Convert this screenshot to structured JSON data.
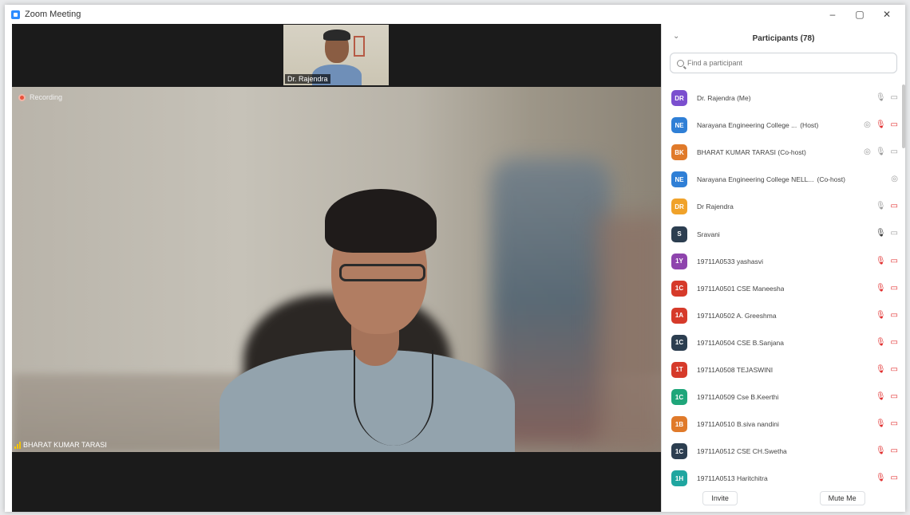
{
  "window": {
    "title": "Zoom Meeting",
    "controls": [
      "–",
      "▢",
      "✕"
    ]
  },
  "video": {
    "thumbnail_name": "Dr. Rajendra",
    "recording_label": "Recording",
    "speaker_name": "BHARAT KUMAR TARASI"
  },
  "participants": {
    "title": "Participants (78)",
    "search_placeholder": "Find a participant",
    "list": [
      {
        "initials": "DR",
        "color": "#7b4fcf",
        "name": "Dr. Rajendra (Me)",
        "role": "",
        "icons": [
          "mic",
          "cam"
        ]
      },
      {
        "initials": "NE",
        "color": "#2f7fd6",
        "name": "Narayana Engineering College ...",
        "role": "(Host)",
        "icons": [
          "share",
          "mic-muted",
          "cam-off"
        ]
      },
      {
        "initials": "BK",
        "color": "#e07a2a",
        "name": "BHARAT KUMAR TARASI (Co-host)",
        "role": "",
        "icons": [
          "share",
          "mic",
          "cam"
        ]
      },
      {
        "initials": "NE",
        "color": "#2f7fd6",
        "name": "Narayana Engineering College NELL...",
        "role": "(Co-host)",
        "icons": [
          "share"
        ]
      },
      {
        "initials": "DR",
        "color": "#f0a22a",
        "name": "Dr Rajendra",
        "role": "",
        "icons": [
          "mic",
          "cam-off"
        ]
      },
      {
        "initials": "S",
        "color": "#2c3e50",
        "name": "Sravani",
        "role": "",
        "icons": [
          "mic-dark",
          "cam"
        ]
      },
      {
        "initials": "1Y",
        "color": "#8e44ad",
        "name": "19711A0533 yashasvi",
        "role": "",
        "icons": [
          "mic-muted",
          "cam-off"
        ]
      },
      {
        "initials": "1C",
        "color": "#d63a2a",
        "name": "19711A0501 CSE Maneesha",
        "role": "",
        "icons": [
          "mic-muted",
          "cam-off"
        ]
      },
      {
        "initials": "1A",
        "color": "#d63a2a",
        "name": "19711A0502 A. Greeshma",
        "role": "",
        "icons": [
          "mic-muted",
          "cam-off"
        ]
      },
      {
        "initials": "1C",
        "color": "#2c3e50",
        "name": "19711A0504 CSE B.Sanjana",
        "role": "",
        "icons": [
          "mic-muted",
          "cam-off"
        ]
      },
      {
        "initials": "1T",
        "color": "#d63a2a",
        "name": "19711A0508 TEJASWINI",
        "role": "",
        "icons": [
          "mic-muted",
          "cam-off"
        ]
      },
      {
        "initials": "1C",
        "color": "#1fa67a",
        "name": "19711A0509 Cse B.Keerthi",
        "role": "",
        "icons": [
          "mic-muted",
          "cam-off"
        ]
      },
      {
        "initials": "1B",
        "color": "#e07a2a",
        "name": "19711A0510 B.siva nandini",
        "role": "",
        "icons": [
          "mic-muted",
          "cam-off"
        ]
      },
      {
        "initials": "1C",
        "color": "#2c3e50",
        "name": "19711A0512 CSE CH.Swetha",
        "role": "",
        "icons": [
          "mic-muted",
          "cam-off"
        ]
      },
      {
        "initials": "1H",
        "color": "#1fa6a0",
        "name": "19711A0513 Haritchitra",
        "role": "",
        "icons": [
          "mic-muted",
          "cam-off"
        ]
      }
    ],
    "invite_label": "Invite",
    "mute_me_label": "Mute Me"
  }
}
